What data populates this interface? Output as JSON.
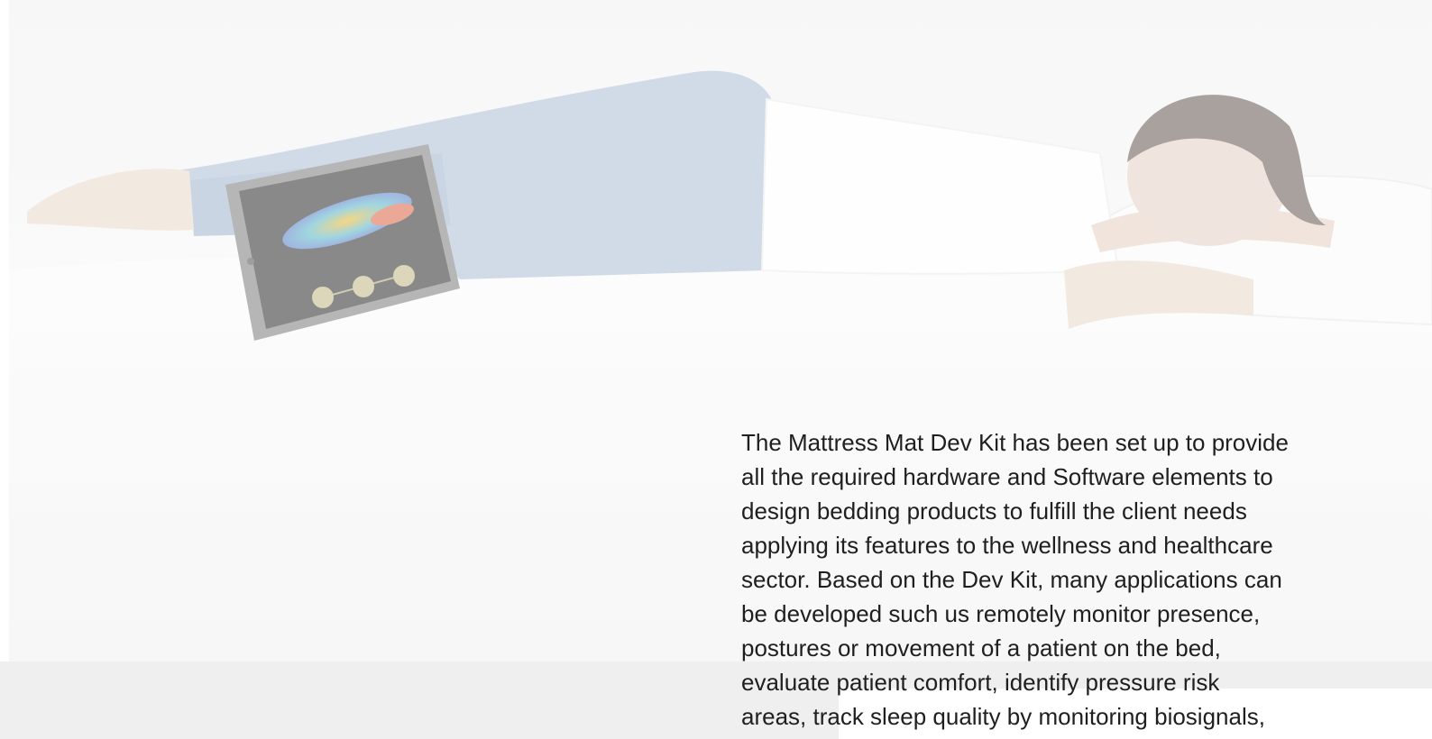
{
  "hero": {
    "image_alt": "Woman sleeping on a mattress next to a tablet showing a pressure map",
    "tablet_screen": "pressure-map-heatmap",
    "icons": [
      "circle-button-icon",
      "circle-button-icon",
      "circle-button-icon"
    ]
  },
  "description": {
    "text": "The Mattress Mat Dev Kit has been set up to provide\nall the required hardware and Software elements to\ndesign bedding products to fulfill the client needs\napplying its features to the wellness and healthcare\nsector. Based on the Dev Kit, many applications can\nbe developed such us remotely monitor presence,\npostures or movement of a patient on the bed,\nevaluate patient comfort, identify pressure risk\nareas, track sleep quality by monitoring biosignals,"
  },
  "colors": {
    "background": "#ffffff",
    "hero_tint": "#f4f4f4",
    "jeans": "#b9c8dc",
    "skin": "#ead9cd",
    "hair": "#7c6f6a",
    "text": "#1f1f1f"
  }
}
